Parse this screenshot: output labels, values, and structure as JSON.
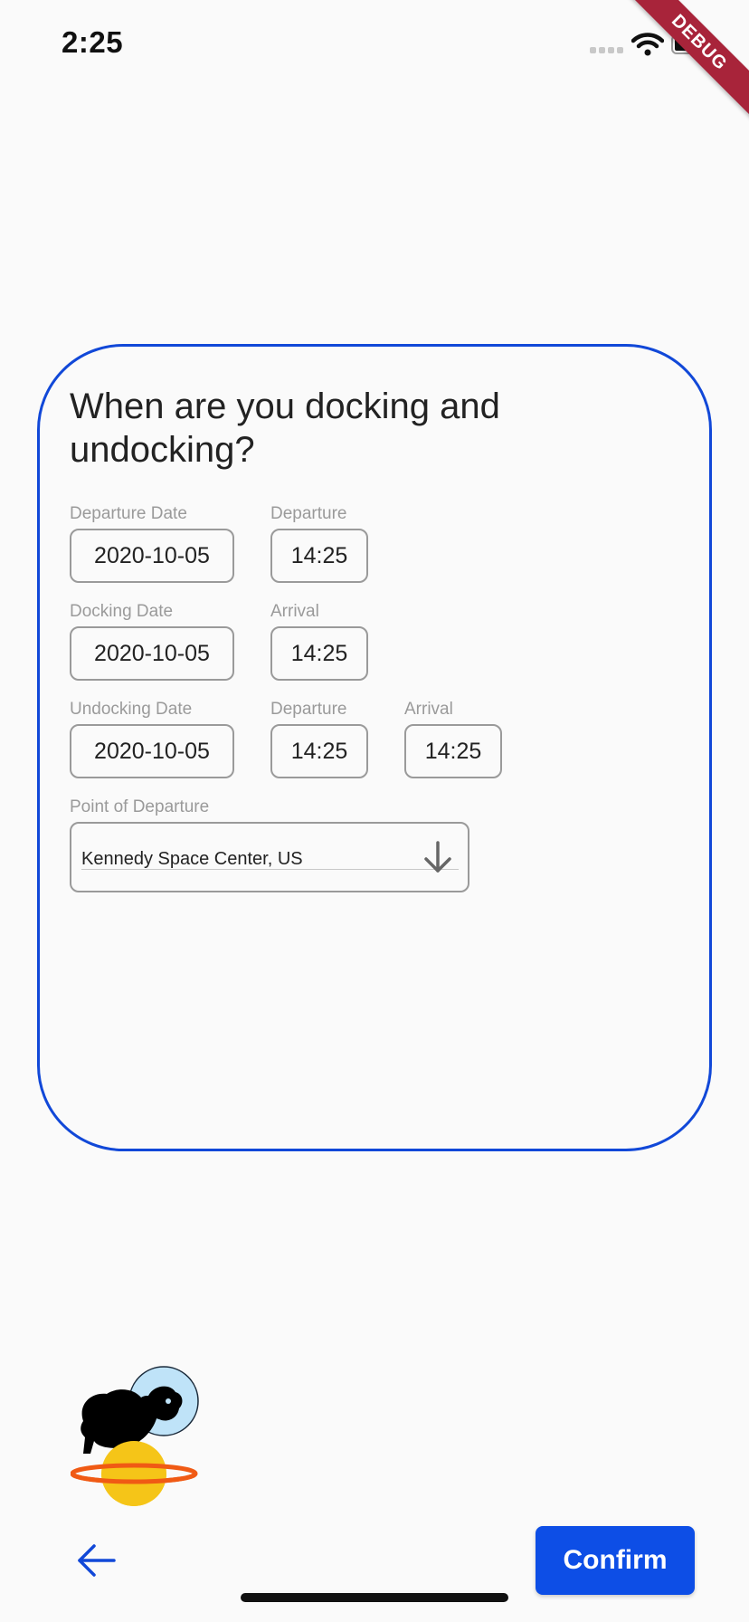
{
  "status_bar": {
    "time": "2:25"
  },
  "debug_banner": "DEBUG",
  "card": {
    "title": "When are you docking and undocking?",
    "departure": {
      "date_label": "Departure Date",
      "date_value": "2020-10-05",
      "time_label": "Departure",
      "time_value": "14:25"
    },
    "docking": {
      "date_label": "Docking Date",
      "date_value": "2020-10-05",
      "time_label": "Arrival",
      "time_value": "14:25"
    },
    "undocking": {
      "date_label": "Undocking Date",
      "date_value": "2020-10-05",
      "departure_label": "Departure",
      "departure_value": "14:25",
      "arrival_label": "Arrival",
      "arrival_value": "14:25"
    },
    "point_of_departure": {
      "label": "Point of Departure",
      "value": "Kennedy Space Center, US"
    }
  },
  "footer": {
    "confirm_label": "Confirm"
  },
  "colors": {
    "accent": "#1148d8",
    "button": "#0d4ee6",
    "planet": "#f5c518",
    "ring": "#f05a14",
    "helmet": "#bfe3f8"
  },
  "icons": {
    "back": "arrow-left-icon",
    "dropdown": "arrow-down-icon",
    "wifi": "wifi-icon",
    "battery": "battery-icon"
  }
}
